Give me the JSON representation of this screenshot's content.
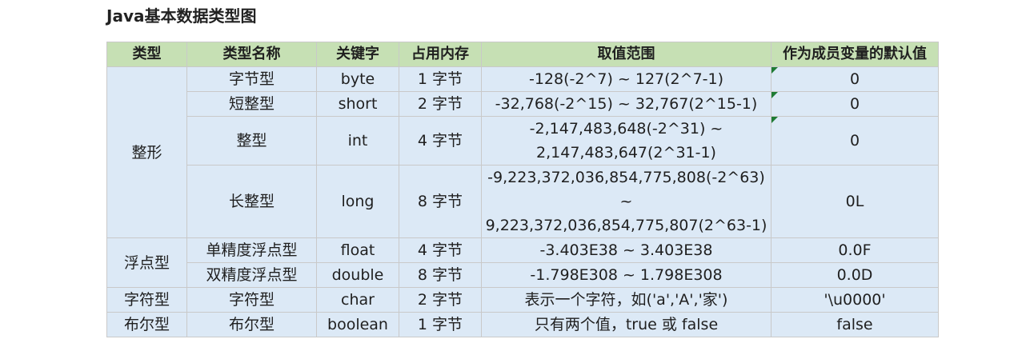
{
  "heading": "Java基本数据类型图",
  "table": {
    "headers": [
      "类型",
      "类型名称",
      "关键字",
      "占用内存",
      "取值范围",
      "作为成员变量的默认值"
    ],
    "groups": [
      {
        "category": "整形",
        "rows": [
          {
            "name": "字节型",
            "keyword": "byte",
            "memory": "1 字节",
            "range": [
              "-128(-2^7) ~ 127(2^7-1)"
            ],
            "default": "0",
            "flag": true
          },
          {
            "name": "短整型",
            "keyword": "short",
            "memory": "2 字节",
            "range": [
              "-32,768(-2^15) ~ 32,767(2^15-1)"
            ],
            "default": "0",
            "flag": true
          },
          {
            "name": "整型",
            "keyword": "int",
            "memory": "4 字节",
            "range": [
              "-2,147,483,648(-2^31) ~",
              "2,147,483,647(2^31-1)"
            ],
            "default": "0",
            "flag": true
          },
          {
            "name": "长整型",
            "keyword": "long",
            "memory": "8 字节",
            "range": [
              "-9,223,372,036,854,775,808(-2^63) ~",
              "9,223,372,036,854,775,807(2^63-1)"
            ],
            "default": "0L",
            "flag": false
          }
        ]
      },
      {
        "category": "浮点型",
        "rows": [
          {
            "name": "单精度浮点型",
            "keyword": "float",
            "memory": "4 字节",
            "range": [
              "-3.403E38 ~ 3.403E38"
            ],
            "default": "0.0F",
            "flag": false
          },
          {
            "name": "双精度浮点型",
            "keyword": "double",
            "memory": "8 字节",
            "range": [
              "-1.798E308 ~ 1.798E308"
            ],
            "default": "0.0D",
            "flag": false
          }
        ]
      },
      {
        "category": "字符型",
        "rows": [
          {
            "name": "字符型",
            "keyword": "char",
            "memory": "2 字节",
            "range": [
              "表示一个字符，如('a','A','家')"
            ],
            "default": "'\\u0000'",
            "flag": false
          }
        ]
      },
      {
        "category": "布尔型",
        "rows": [
          {
            "name": "布尔型",
            "keyword": "boolean",
            "memory": "1 字节",
            "range": [
              "只有两个值，true 或 false"
            ],
            "default": "false",
            "flag": false
          }
        ]
      }
    ],
    "colors": {
      "header_bg": "#c6e0b4",
      "cell_bg": "#dce9f6",
      "border": "#c9c9c9",
      "comment_flag": "#1e7b34"
    }
  }
}
